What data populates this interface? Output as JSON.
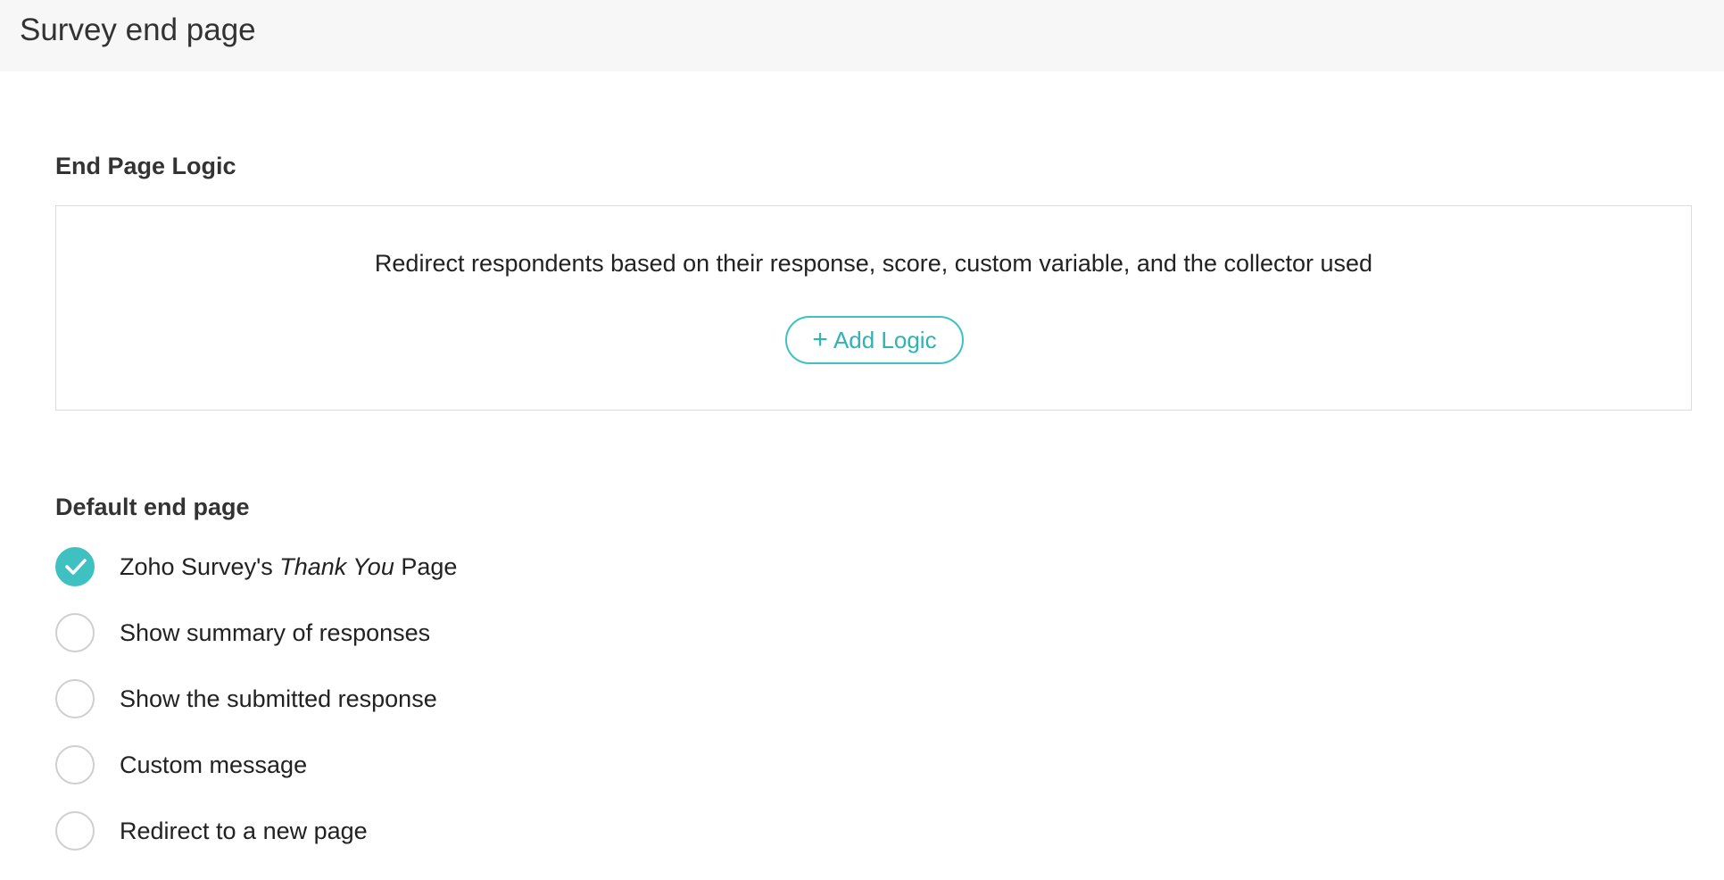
{
  "header": {
    "title": "Survey end page"
  },
  "end_page_logic": {
    "title": "End Page Logic",
    "description": "Redirect respondents based on their response, score, custom variable, and the collector used",
    "add_logic_plus": "+",
    "add_logic_label": "Add Logic"
  },
  "default_end_page": {
    "title": "Default end page",
    "selected_index": 0,
    "options": [
      {
        "prefix": "Zoho Survey's ",
        "emphasis": "Thank You",
        "suffix": " Page",
        "checked": true
      },
      {
        "label": "Show summary of responses",
        "checked": false
      },
      {
        "label": "Show the submitted response",
        "checked": false
      },
      {
        "label": "Custom message",
        "checked": false
      },
      {
        "label": "Redirect to a new page",
        "checked": false
      }
    ]
  },
  "colors": {
    "accent": "#3fc1c1",
    "header_bg": "#f7f7f7",
    "border": "#dcdcdc",
    "radio_border": "#cfcfcf"
  },
  "icons": {
    "checked_radio": "checkmark-icon",
    "add_logic": "plus-icon"
  }
}
